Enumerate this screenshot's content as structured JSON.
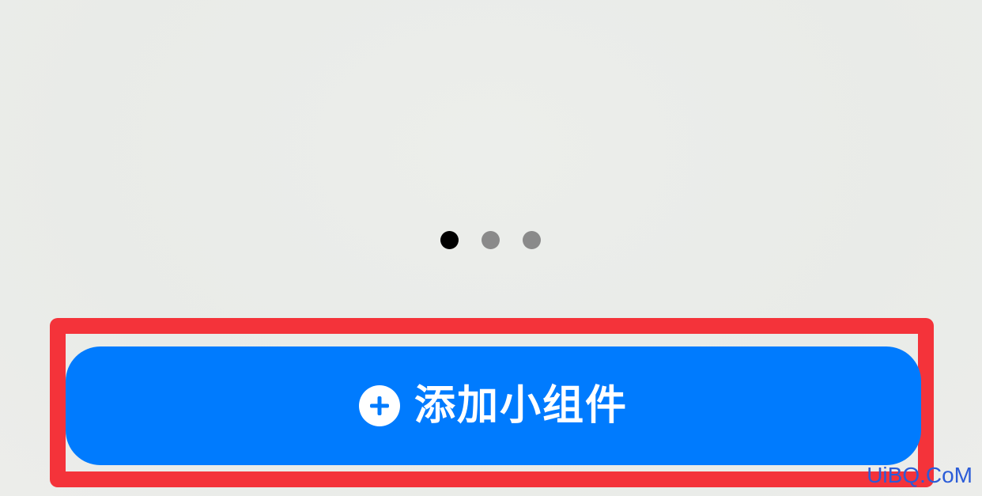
{
  "page_indicator": {
    "count": 3,
    "active_index": 0
  },
  "add_widget_button": {
    "label": "添加小组件",
    "icon": "plus-circle-icon"
  },
  "watermark": {
    "text": "UiBQ.CoM"
  },
  "colors": {
    "button": "#007bfe",
    "highlight": "#f4333a",
    "dot_active": "#000000",
    "dot_inactive": "#8a8a8a",
    "background": "#ebedea"
  }
}
